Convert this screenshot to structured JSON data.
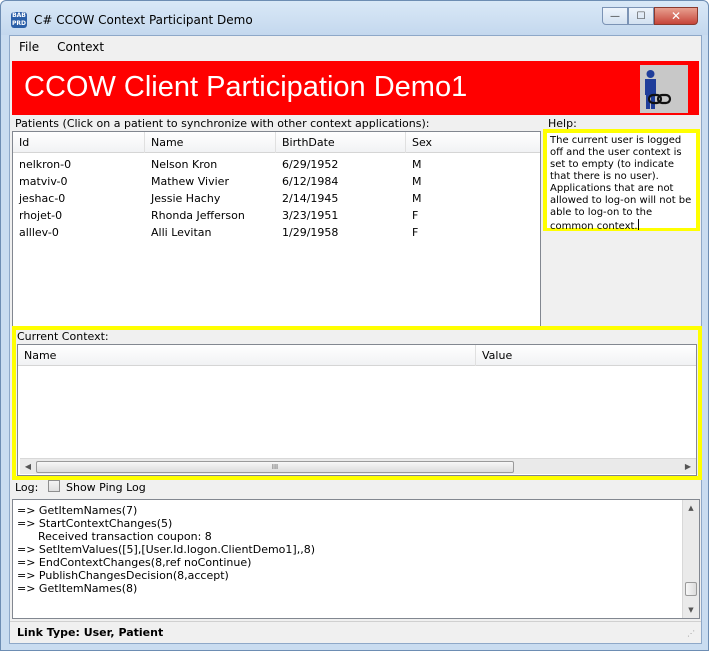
{
  "window": {
    "title": "C# CCOW Context Participant Demo",
    "icon_text": "BAB\nPRD",
    "min_glyph": "—",
    "max_glyph": "☐",
    "close_glyph": "✕"
  },
  "menu": {
    "file": "File",
    "context": "Context"
  },
  "banner": {
    "title": "CCOW Client Participation Demo1",
    "background": "#ff0000"
  },
  "patients": {
    "label": "Patients (Click on a patient to synchronize with other context applications):",
    "columns": [
      "Id",
      "Name",
      "BirthDate",
      "Sex"
    ],
    "rows": [
      [
        "nelkron-0",
        "Nelson Kron",
        "6/29/1952",
        "M"
      ],
      [
        "matviv-0",
        "Mathew Vivier",
        "6/12/1984",
        "M"
      ],
      [
        "jeshac-0",
        "Jessie Hachy",
        "2/14/1945",
        "M"
      ],
      [
        "rhojet-0",
        "Rhonda Jefferson",
        "3/23/1951",
        "F"
      ],
      [
        "alllev-0",
        "Alli Levitan",
        "1/29/1958",
        "F"
      ]
    ]
  },
  "help": {
    "label": "Help:",
    "text": "The current user is logged off and the user context is set to empty (to indicate that there is no user). Applications that are not allowed to log-on will not be able to log-on to the common context."
  },
  "current_context": {
    "label": "Current Context:",
    "columns": [
      "Name",
      "Value"
    ],
    "scroll_left": "◀",
    "scroll_right": "▶",
    "thumb_grip": "III"
  },
  "log": {
    "label": "Log:",
    "show_ping_label": "Show Ping Log",
    "show_ping_checked": false,
    "lines": [
      "=> GetItemNames(7)",
      "=> StartContextChanges(5)",
      "      Received transaction coupon: 8",
      "=> SetItemValues([5],[User.Id.logon.ClientDemo1],,8)",
      "=> EndContextChanges(8,ref noContinue)",
      "=> PublishChangesDecision(8,accept)",
      "=> GetItemNames(8)"
    ],
    "scroll_up": "▲",
    "scroll_down": "▼"
  },
  "status": {
    "text": "Link Type: User, Patient",
    "grip": "⋰"
  },
  "colors": {
    "highlight": "#ffff00",
    "banner": "#ff0000"
  }
}
